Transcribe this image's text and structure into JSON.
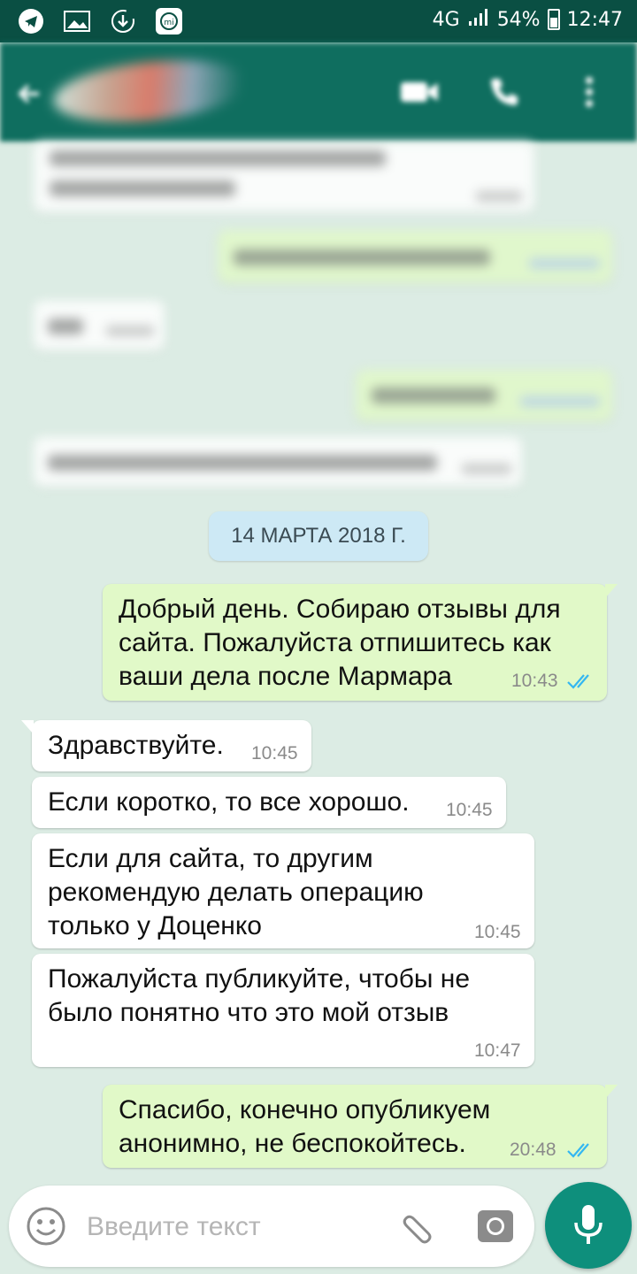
{
  "status_bar": {
    "network": "4G",
    "battery": "54%",
    "time": "12:47",
    "icons": [
      "telegram-icon",
      "image-icon",
      "download-icon",
      "mi-icon",
      "signal-icon",
      "battery-icon"
    ]
  },
  "header": {
    "contact_name": "",
    "actions": [
      "video-call-icon",
      "call-icon",
      "more-icon"
    ]
  },
  "chat": {
    "date_divider": "14 МАРТА 2018 Г.",
    "messages": [
      {
        "direction": "out",
        "text": "Добрый день. Собираю отзывы для сайта. Пожалуйста отпишитесь как ваши дела после Мармара",
        "time": "10:43",
        "status": "read"
      },
      {
        "direction": "in",
        "text": "Здравствуйте.",
        "time": "10:45"
      },
      {
        "direction": "in",
        "text": "Если коротко, то все хорошо.",
        "time": "10:45"
      },
      {
        "direction": "in",
        "text": "Если для сайта, то другим рекомендую делать операцию только у Доценко",
        "time": "10:45"
      },
      {
        "direction": "in",
        "text": "Пожалуйста публикуйте, чтобы не было понятно что это мой отзыв",
        "time": "10:47"
      },
      {
        "direction": "out",
        "text": "Спасибо, конечно опубликуем анонимно, не беспокойтесь.",
        "time": "20:48",
        "status": "read"
      }
    ]
  },
  "composer": {
    "placeholder": "Введите текст"
  },
  "colors": {
    "header": "#0f6e5f",
    "status_bar": "#0a4f43",
    "outgoing_bubble": "#e1f9c8",
    "incoming_bubble": "#ffffff",
    "read_ticks": "#34b7f1",
    "mic_button": "#0e8f7c"
  }
}
